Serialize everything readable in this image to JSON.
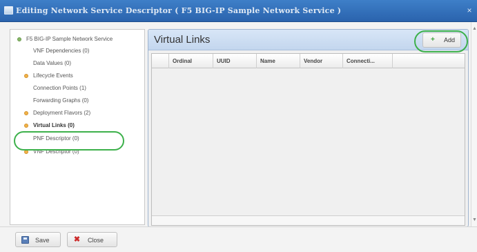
{
  "window": {
    "title": "Editing Network Service Descriptor ( F5 BIG-IP Sample Network Service )",
    "close_glyph": "×"
  },
  "tree": {
    "root": "F5 BIG-IP Sample Network Service",
    "items": [
      {
        "label": "VNF Dependencies (0)",
        "expandable": false
      },
      {
        "label": "Data Values (0)",
        "expandable": false
      },
      {
        "label": "Lifecycle Events",
        "expandable": true
      },
      {
        "label": "Connection Points (1)",
        "expandable": false
      },
      {
        "label": "Forwarding Graphs (0)",
        "expandable": false
      },
      {
        "label": "Deployment Flavors (2)",
        "expandable": true
      },
      {
        "label": "Virtual Links (0)",
        "expandable": true,
        "selected": true
      },
      {
        "label": "PNF Descriptor (0)",
        "expandable": false
      },
      {
        "label": "VNF Descriptor (0)",
        "expandable": true
      }
    ]
  },
  "panel": {
    "title": "Virtual Links",
    "add_label": "Add",
    "add_glyph": "+"
  },
  "grid": {
    "columns": [
      "Ordinal",
      "UUID",
      "Name",
      "Vendor",
      "Connecti..."
    ],
    "rows": []
  },
  "footer": {
    "save_label": "Save",
    "close_label": "Close",
    "close_glyph": "✖"
  },
  "colors": {
    "titlebar": "#2f6db8",
    "highlight": "#3cb04a",
    "expand_dot": "#f0b34a",
    "root_dot": "#88b76a"
  }
}
